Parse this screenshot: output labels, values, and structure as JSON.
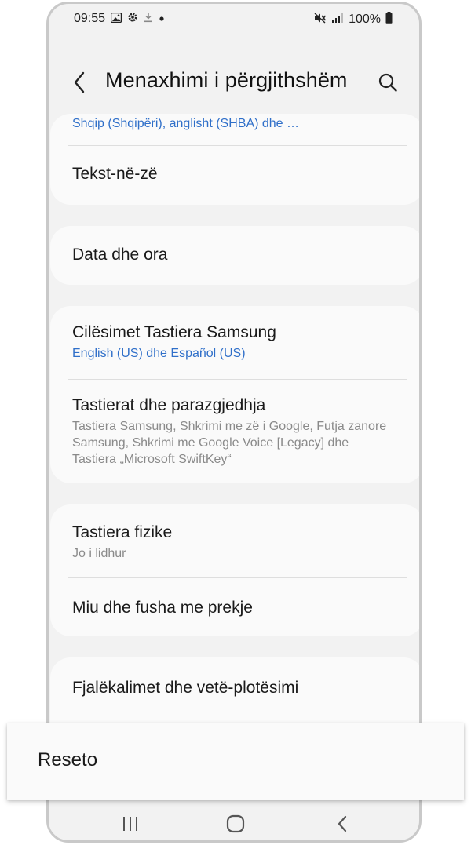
{
  "status_bar": {
    "time": "09:55",
    "battery": "100%",
    "left_icons": [
      "gallery-icon",
      "gear-icon",
      "download-icon",
      "dot-icon"
    ],
    "right_icons": [
      "mute-icon",
      "signal-icon",
      "battery-icon"
    ]
  },
  "header": {
    "title": "Menaxhimi i përgjithshëm"
  },
  "cards": {
    "languages": {
      "subtitle": "Shqip (Shqipëri), anglisht (SHBA) dhe …",
      "tts_title": "Tekst-në-zë"
    },
    "date_time": {
      "title": "Data dhe ora"
    },
    "keyboards": {
      "samsung_title": "Cilësimet Tastiera Samsung",
      "samsung_subtitle": "English (US) dhe Español (US)",
      "list_title": "Tastierat dhe parazgjedhja",
      "list_subtitle": "Tastiera Samsung, Shkrimi me zë i Google, Futja zanore Samsung, Shkrimi me Google Voice [Legacy] dhe Tastiera „Microsoft SwiftKey“"
    },
    "physical": {
      "title": "Tastiera fizike",
      "subtitle": "Jo i lidhur",
      "mouse_title": "Miu dhe fusha me prekje"
    },
    "passwords": {
      "title": "Fjalëkalimet dhe vetë-plotësimi"
    }
  },
  "popup": {
    "label": "Reseto"
  },
  "colors": {
    "accent_blue": "#2f6fc9",
    "background": "#f2f2f2",
    "card": "#fafafa"
  }
}
